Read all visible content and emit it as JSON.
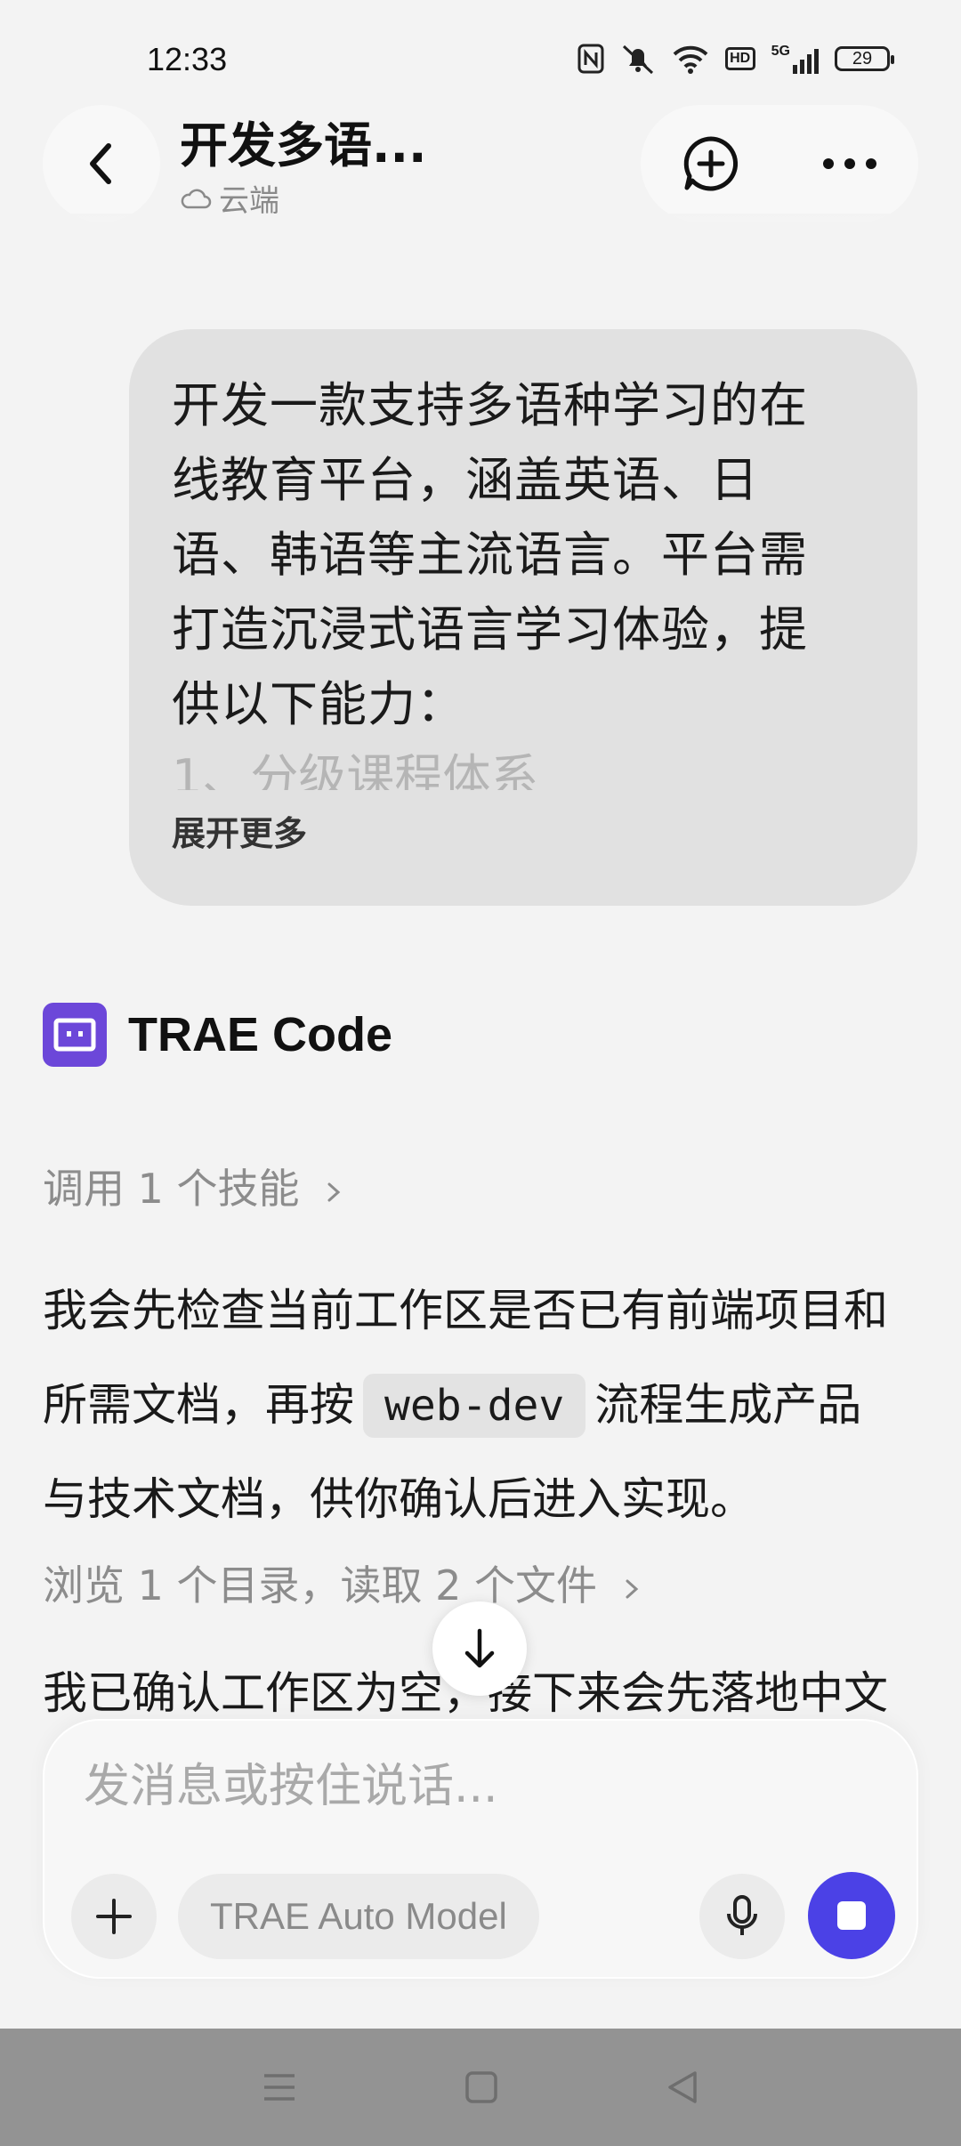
{
  "status_bar": {
    "time": "12:33",
    "network": "5G",
    "hd_label": "HD",
    "battery": "29"
  },
  "header": {
    "title": "开发多语...",
    "location": "云端"
  },
  "user_message": {
    "lines": [
      "开发一款支持多语种学习的在",
      "线教育平台，涵盖英语、日",
      "语、韩语等主流语言。平台需",
      "打造沉浸式语言学习体验，提",
      "供以下能力："
    ],
    "faded_line": "1、分级课程体系",
    "expand_label": "展开更多"
  },
  "bot": {
    "name": "TRAE Code",
    "skill_summary": "调用 1 个技能",
    "reply_line1": "我会先检查当前工作区是否已有前端项目和",
    "reply_line2_pre": "所需文档，再按",
    "reply_code": "web-dev",
    "reply_line2_post": "流程生成产品",
    "reply_line3": "与技术文档，供你确认后进入实现。",
    "browse_summary": "浏览 1 个目录，读取 2 个文件",
    "partial_line": "我已确认工作区为空，接下来会先落地中文"
  },
  "composer": {
    "placeholder": "发消息或按住说话...",
    "model_label": "TRAE Auto Model"
  },
  "colors": {
    "accent": "#4b41e6",
    "bot_logo": "#6c47d9",
    "nav_bar": "#939393"
  }
}
